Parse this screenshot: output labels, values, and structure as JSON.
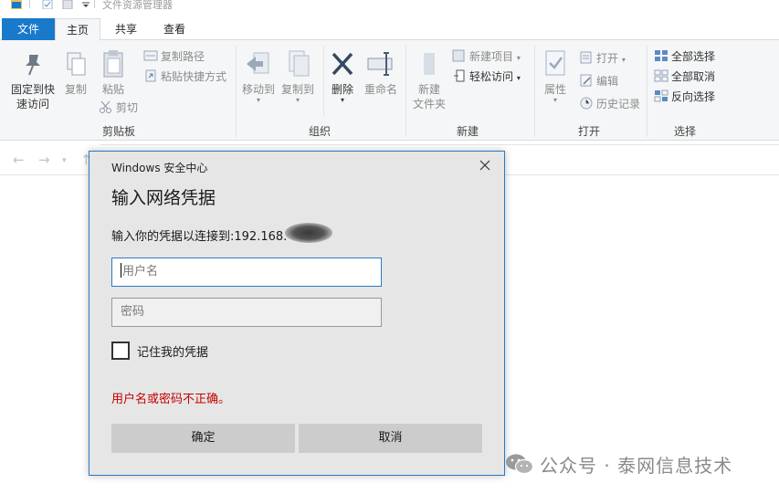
{
  "window": {
    "title": "文件资源管理器"
  },
  "tabs": [
    {
      "label": "文件",
      "active": false,
      "accent": "#1979ca"
    },
    {
      "label": "主页",
      "active": true
    },
    {
      "label": "共享",
      "active": false
    },
    {
      "label": "查看",
      "active": false
    }
  ],
  "ribbon": {
    "clipboard": {
      "label": "剪贴板",
      "pin": "固定到快",
      "pin2": "速访问",
      "copy": "复制",
      "paste": "粘贴",
      "copy_path": "复制路径",
      "paste_shortcut": "粘贴快捷方式",
      "cut": "剪切"
    },
    "organize": {
      "label": "组织",
      "move_to": "移动到",
      "copy_to": "复制到",
      "delete": "删除",
      "rename": "重命名"
    },
    "new": {
      "label": "新建",
      "new_folder": "新建",
      "new_folder2": "文件夹",
      "new_item": "新建项目",
      "easy_access": "轻松访问"
    },
    "open": {
      "label": "打开",
      "properties": "属性",
      "open": "打开",
      "edit": "编辑",
      "history": "历史记录"
    },
    "select": {
      "label": "选择",
      "select_all": "全部选择",
      "select_none": "全部取消",
      "invert": "反向选择"
    }
  },
  "dialog": {
    "caption": "Windows 安全中心",
    "title": "输入网络凭据",
    "prompt": "输入你的凭据以连接到:192.168.",
    "username_placeholder": "用户名",
    "password_placeholder": "密码",
    "remember_label": "记住我的凭据",
    "remember_checked": false,
    "error": "用户名或密码不正确。",
    "ok_label": "确定",
    "cancel_label": "取消",
    "error_color": "#c50000",
    "border_color": "#2b79c2"
  },
  "watermark": {
    "text": "公众号 · 泰网信息技术",
    "icon": "wechat-icon"
  }
}
